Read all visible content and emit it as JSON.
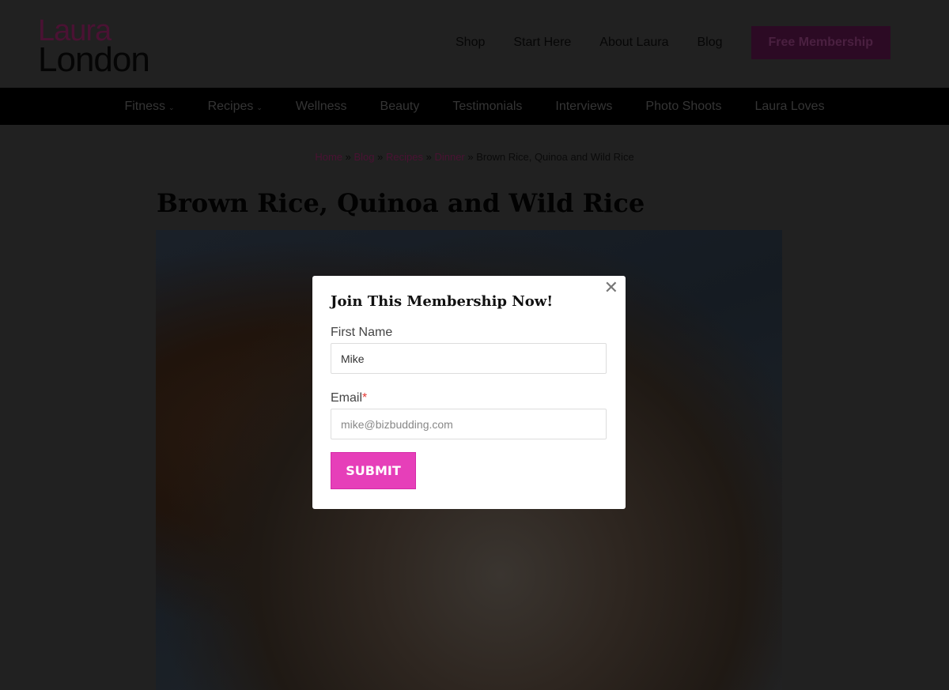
{
  "logo": {
    "line1": "Laura",
    "line2": "London"
  },
  "topnav": {
    "items": [
      "Shop",
      "Start Here",
      "About Laura",
      "Blog"
    ],
    "cta": "Free Membership"
  },
  "catnav": {
    "items": [
      {
        "label": "Fitness",
        "dropdown": true
      },
      {
        "label": "Recipes",
        "dropdown": true
      },
      {
        "label": "Wellness"
      },
      {
        "label": "Beauty"
      },
      {
        "label": "Testimonials"
      },
      {
        "label": "Interviews"
      },
      {
        "label": "Photo Shoots"
      },
      {
        "label": "Laura Loves"
      }
    ],
    "chevron": "⌄"
  },
  "breadcrumb": {
    "links": [
      "Home",
      "Blog",
      "Recipes",
      "Dinner"
    ],
    "separator": "»",
    "current": "Brown Rice, Quinoa and Wild Rice"
  },
  "post": {
    "title": "Brown Rice, Quinoa and Wild Rice"
  },
  "modal": {
    "close": "✕",
    "title": "Join This Membership Now!",
    "first_name_label": "First Name",
    "first_name_value": "Mike",
    "email_label": "Email",
    "required_mark": "*",
    "email_placeholder": "mike@bizbudding.com",
    "submit": "SUBMIT"
  },
  "colors": {
    "brand": "#c2187d",
    "submit": "#e63fb9"
  }
}
